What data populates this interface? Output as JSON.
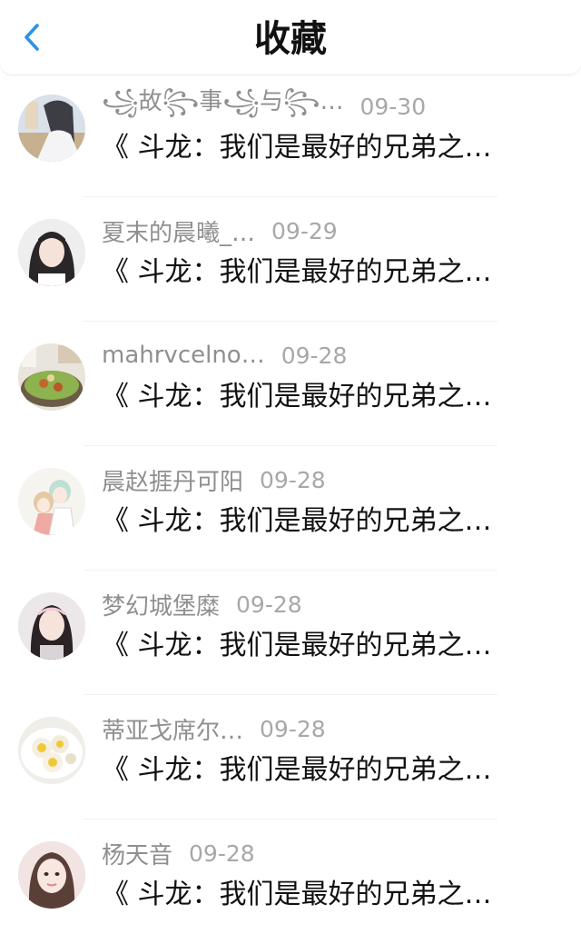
{
  "header": {
    "title": "收藏",
    "back_icon": "chevron-left-icon",
    "accent_color": "#2a93e8"
  },
  "items": [
    {
      "author": "꧁故꧂事꧁与꧂…",
      "date": "09-30",
      "title": "《 斗龙：我们是最好的兄弟之…",
      "avatar_icon": "avatar-anime-girl-icon"
    },
    {
      "author": "夏末的晨曦_…",
      "date": "09-29",
      "title": "《 斗龙：我们是最好的兄弟之…",
      "avatar_icon": "avatar-girl-portrait-icon"
    },
    {
      "author": "mahrvcelno…",
      "date": "09-28",
      "title": "《 斗龙：我们是最好的兄弟之…",
      "avatar_icon": "avatar-food-bowl-icon"
    },
    {
      "author": "晨赵捱丹可阳",
      "date": "09-28",
      "title": "《 斗龙：我们是最好的兄弟之…",
      "avatar_icon": "avatar-anime-couple-icon"
    },
    {
      "author": "梦幻城堡糜",
      "date": "09-28",
      "title": "《 斗龙：我们是最好的兄弟之…",
      "avatar_icon": "avatar-girl-headband-icon"
    },
    {
      "author": "蒂亚戈席尔…",
      "date": "09-28",
      "title": "《 斗龙：我们是最好的兄弟之…",
      "avatar_icon": "avatar-food-plate-icon"
    },
    {
      "author": "杨天音",
      "date": "09-28",
      "title": "《 斗龙：我们是最好的兄弟之…",
      "avatar_icon": "avatar-girl-selfie-icon"
    }
  ]
}
